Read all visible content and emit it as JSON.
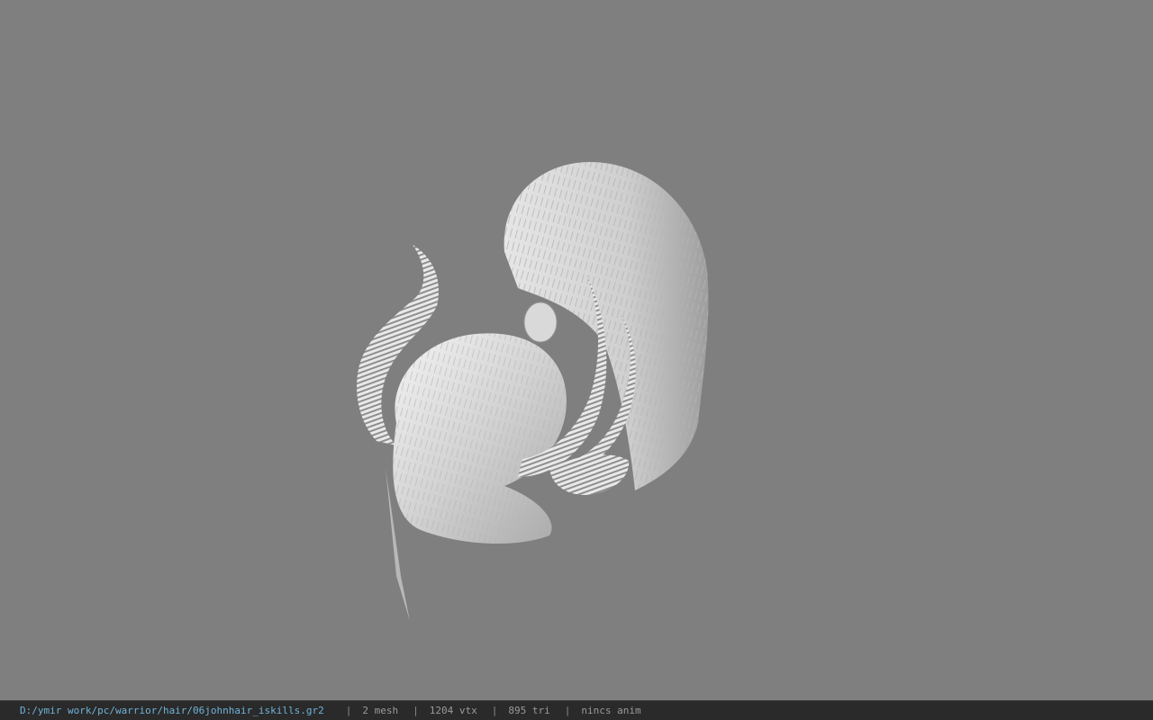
{
  "status_bar": {
    "file_path": "D:/ymir work/pc/warrior/hair/06johnhair_iskills.gr2",
    "separator": "|",
    "mesh": "2 mesh",
    "vertices": "1204 vtx",
    "triangles": "895 tri",
    "animation": "nincs anim"
  },
  "colors": {
    "viewport_background": "#7f7f7f",
    "status_bar_background": "#2a2a2a",
    "file_path_text": "#6fb3d9",
    "status_text": "#9a9a9a"
  }
}
